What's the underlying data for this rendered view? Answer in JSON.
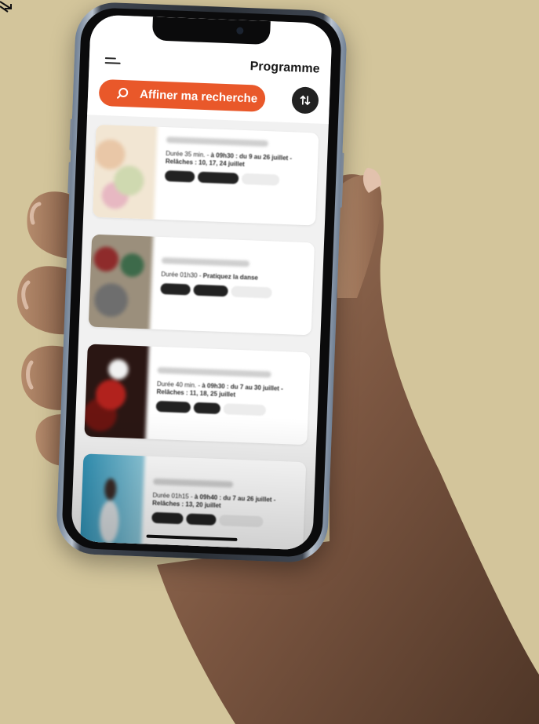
{
  "header": {
    "title": "Programme",
    "menu_icon": "menu-icon"
  },
  "search": {
    "label": "Affiner ma recherche",
    "icon": "search-icon",
    "color": "#e9582a"
  },
  "sort": {
    "icon": "sort-arrows-icon"
  },
  "events": [
    {
      "meta_prefix": "Durée 35 min. - ",
      "meta_bold": "à 09h30 : du 9 au 26 juillet - Relâches : 10, 17, 24 juillet",
      "tags": [
        "dark",
        "dark",
        "light"
      ]
    },
    {
      "meta_prefix": "Durée 01h30 - ",
      "meta_bold": "Pratiquez la danse",
      "tags": [
        "dark",
        "dark",
        "light"
      ]
    },
    {
      "meta_prefix": "Durée 40 min. - ",
      "meta_bold": "à 09h30 : du 7 au 30 juillet - Relâches : 11, 18, 25 juillet",
      "tags": [
        "dark",
        "dark",
        "light"
      ]
    },
    {
      "meta_prefix": "Durée 01h15 - ",
      "meta_bold": "à 09h40 : du 7 au 26 juillet - Relâches : 13, 20 juillet",
      "tags": [
        "dark",
        "dark",
        "light"
      ]
    }
  ],
  "colors": {
    "background": "#d3c59b",
    "accent": "#e9582a",
    "dark": "#222222"
  }
}
